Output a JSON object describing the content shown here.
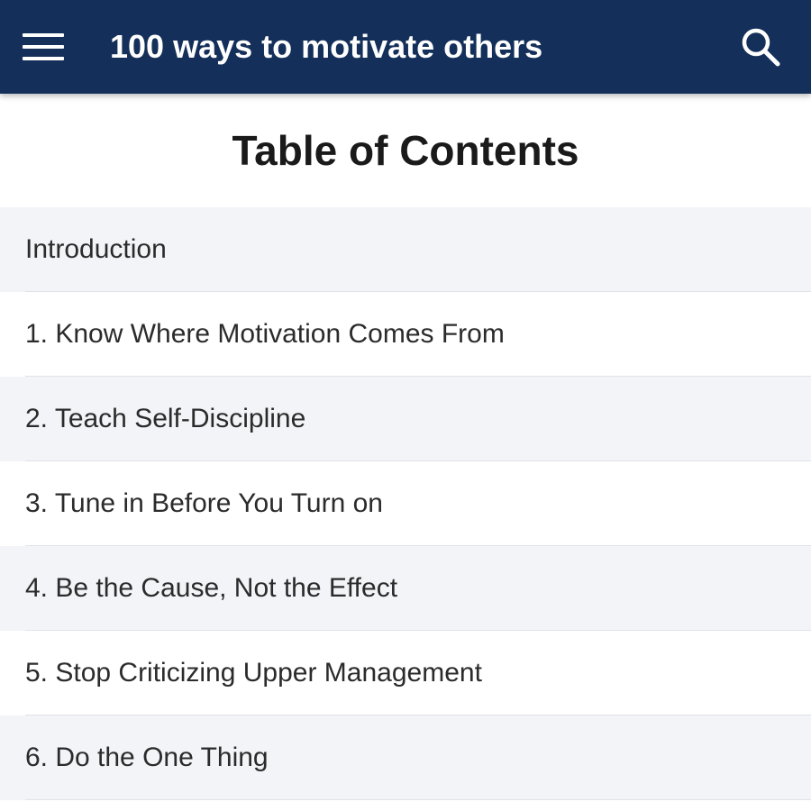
{
  "app_bar": {
    "title": "100 ways to motivate others",
    "background_color": "#14305a",
    "menu_icon": "hamburger-menu-icon",
    "search_icon": "search-icon"
  },
  "page": {
    "heading": "Table of Contents"
  },
  "toc": {
    "items": [
      {
        "label": "Introduction"
      },
      {
        "label": "1. Know Where Motivation Comes From"
      },
      {
        "label": "2. Teach Self-Discipline"
      },
      {
        "label": "3. Tune in Before You Turn on"
      },
      {
        "label": "4. Be the Cause, Not the Effect"
      },
      {
        "label": "5. Stop Criticizing Upper Management"
      },
      {
        "label": "6. Do the One Thing"
      }
    ]
  }
}
